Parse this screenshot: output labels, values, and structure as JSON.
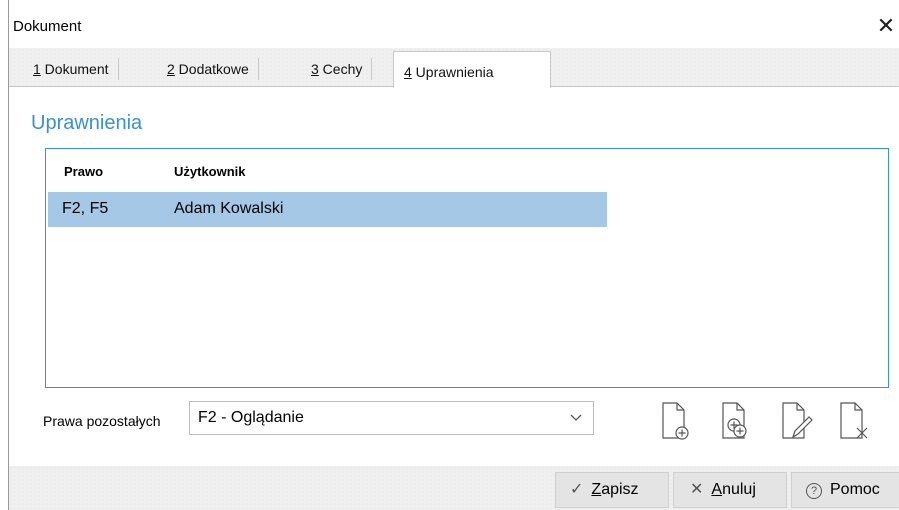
{
  "window": {
    "title": "Dokument",
    "close_glyph": "✕"
  },
  "tabs": [
    {
      "accel": "1",
      "rest": " Dokument",
      "active": false
    },
    {
      "accel": "2",
      "rest": " Dodatkowe",
      "active": false
    },
    {
      "accel": "3",
      "rest": " Cechy",
      "active": false
    },
    {
      "accel": "4",
      "rest": " Uprawnienia",
      "active": true
    }
  ],
  "section": {
    "title": "Uprawnienia"
  },
  "list": {
    "columns": [
      "Prawo",
      "Użytkownik"
    ],
    "rows": [
      {
        "prawo": "F2, F5",
        "uzytkownik": "Adam Kowalski",
        "selected": true
      }
    ]
  },
  "others": {
    "label": "Prawa pozostałych",
    "selected": "F2 - Oglądanie"
  },
  "actions": {
    "icons": [
      "add-document-icon",
      "add-from-list-icon",
      "edit-document-icon",
      "delete-document-icon"
    ]
  },
  "footer": {
    "save": {
      "glyph": "✓",
      "accel": "Z",
      "rest": "apisz"
    },
    "cancel": {
      "glyph": "✕",
      "accel": "A",
      "rest": "nuluj"
    },
    "help": {
      "glyph": "?",
      "label": "Pomoc"
    }
  },
  "colors": {
    "accent": "#3a8fd6",
    "selection": "#a5c8e6",
    "list_border": "#3b8ee0"
  }
}
